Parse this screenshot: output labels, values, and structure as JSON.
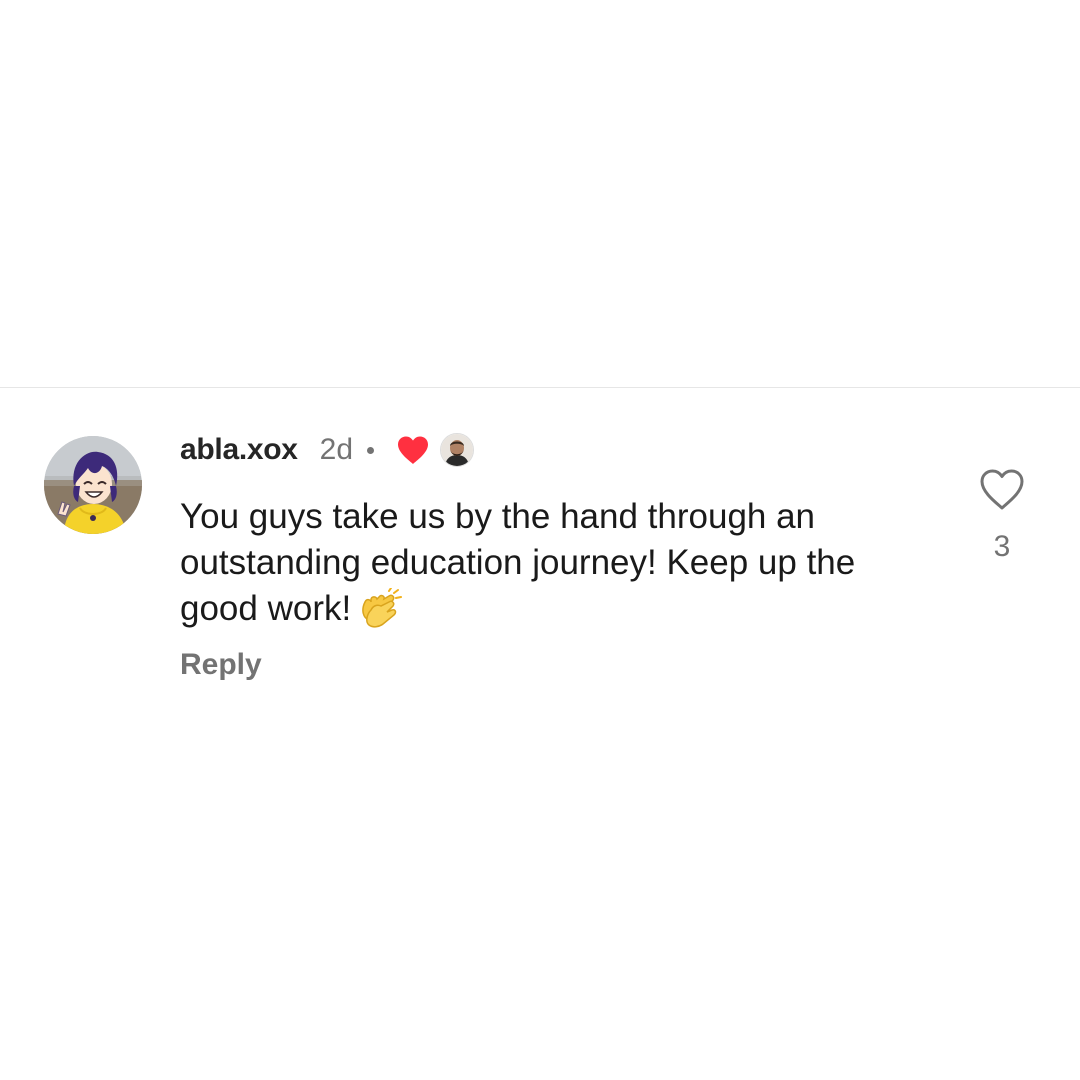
{
  "comment": {
    "username": "abla.xox",
    "time_ago": "2d",
    "text": "You guys take us by the hand through an outstanding education journey! Keep up the good work!",
    "reply_label": "Reply",
    "like_count": "3",
    "liked_by_author": true
  },
  "icons": {
    "author_like": "heart-filled-icon",
    "like": "heart-outline-icon",
    "emoji": "clapping-hands-icon"
  },
  "colors": {
    "heart": "#ff3040",
    "text_primary": "#262626",
    "text_secondary": "#737373",
    "divider": "#e6e6e6"
  }
}
